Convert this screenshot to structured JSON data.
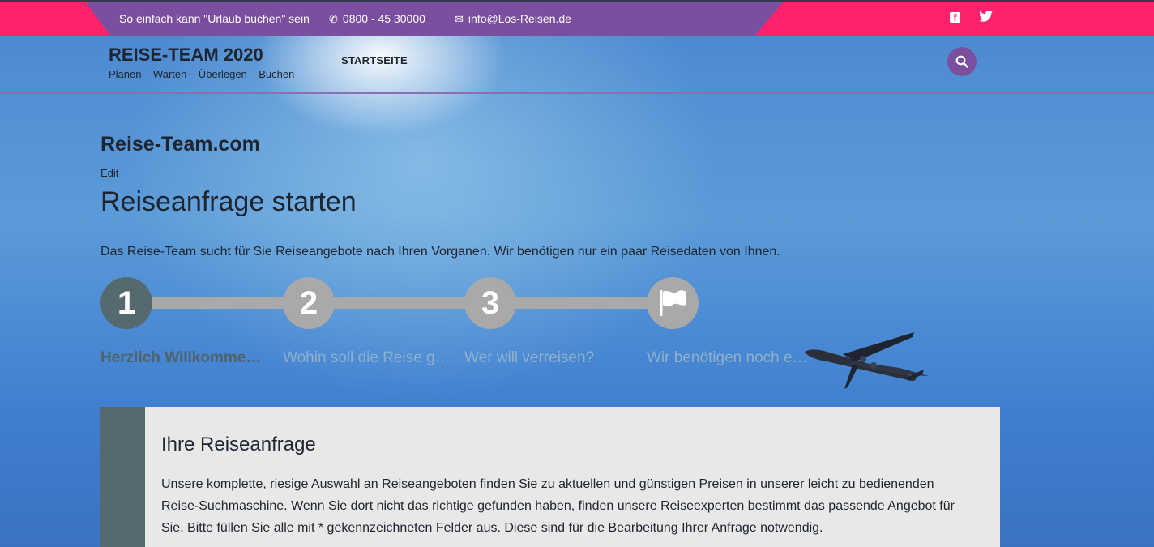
{
  "topbar": {
    "slogan": "So einfach kann \"Urlaub buchen\" sein",
    "phone": "0800 - 45 30000",
    "email": "info@Los-Reisen.de",
    "social": [
      "facebook-icon",
      "twitter-icon"
    ]
  },
  "header": {
    "site_title": "REISE-TEAM 2020",
    "tagline": "Planen – Warten – Überlegen – Buchen",
    "nav_home": "STARTSEITE"
  },
  "main": {
    "site_name": "Reise-Team.com",
    "edit": "Edit",
    "page_title": "Reiseanfrage starten",
    "intro": "Das Reise-Team sucht für Sie Reiseangebote nach Ihren Vorganen. Wir benötigen nur ein paar Reisedaten von Ihnen."
  },
  "steps": [
    {
      "number": "1",
      "label": "Herzlich Willkomme…"
    },
    {
      "number": "2",
      "label": "Wohin soll die Reise g…"
    },
    {
      "number": "3",
      "label": "Wer will verreisen?"
    },
    {
      "number": "",
      "label": "Wir benötigen noch e…"
    }
  ],
  "panel": {
    "title": "Ihre Reiseanfrage",
    "text": "Unsere komplette, riesige Auswahl an Reiseangeboten finden Sie zu aktuellen und günstigen Preisen in unserer leicht zu bedienenden Reise-Suchmaschine. Wenn Sie dort nicht das richtige gefunden haben, finden unsere Reiseexperten bestimmt das passende Angebot für Sie. Bitte füllen Sie alle mit * gekennzeichneten Felder aus. Diese sind für die Bearbeitung Ihrer Anfrage notwendig."
  },
  "colors": {
    "topbar_pink": "#ff2169",
    "topbar_purple": "#7b4fa0",
    "step_active": "#56696f",
    "step_inactive": "#a9a9a9"
  }
}
